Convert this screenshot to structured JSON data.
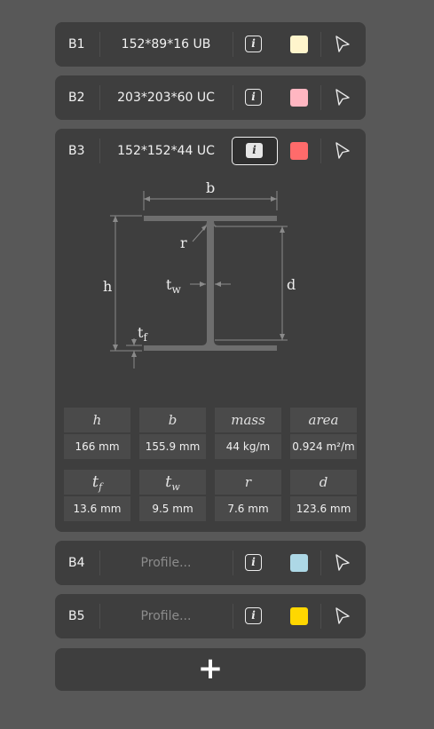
{
  "beams": [
    {
      "id": "B1",
      "profile": "152*89*16 UB",
      "color": "#fff5cc"
    },
    {
      "id": "B2",
      "profile": "203*203*60 UC",
      "color": "#ffb6c1"
    },
    {
      "id": "B3",
      "profile": "152*152*44 UC",
      "color": "#ff6b6b"
    },
    {
      "id": "B4",
      "profile_placeholder": "Profile...",
      "color": "#add8e6"
    },
    {
      "id": "B5",
      "profile_placeholder": "Profile...",
      "color": "#ffd700"
    }
  ],
  "info_icon_glyph": "i",
  "icons": {
    "info": "info-icon",
    "select": "cursor-arrow-icon",
    "add": "plus-icon"
  },
  "diagram_labels": {
    "b": "b",
    "h": "h",
    "r": "r",
    "d": "d",
    "tw": "t",
    "tw_sub": "w",
    "tf": "t",
    "tf_sub": "f"
  },
  "properties": [
    {
      "label": "h",
      "value": "166 mm"
    },
    {
      "label": "b",
      "value": "155.9 mm"
    },
    {
      "label": "mass",
      "value": "44 kg/m"
    },
    {
      "label": "area",
      "value": "0.924 m²/m"
    },
    {
      "label": "t",
      "sub": "f",
      "value": "13.6 mm"
    },
    {
      "label": "t",
      "sub": "w",
      "value": "9.5 mm"
    },
    {
      "label": "r",
      "value": "7.6 mm"
    },
    {
      "label": "d",
      "value": "123.6 mm"
    }
  ],
  "add_button": "+"
}
